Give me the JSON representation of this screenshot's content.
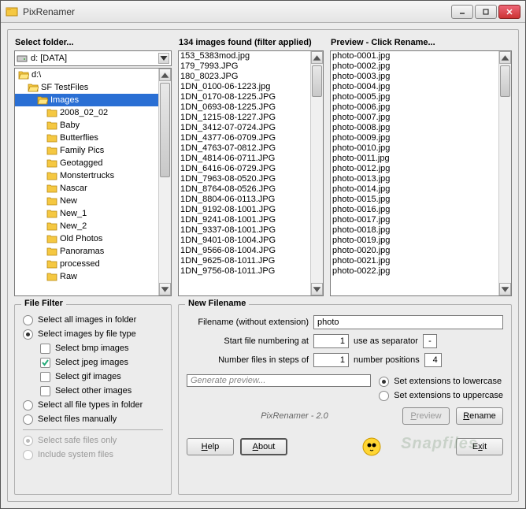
{
  "window": {
    "title": "PixRenamer"
  },
  "folder_panel": {
    "header": "Select folder...",
    "drive": "d: [DATA]",
    "tree": [
      {
        "label": "d:\\",
        "indent": 0,
        "open": true,
        "selected": false
      },
      {
        "label": "SF TestFiles",
        "indent": 1,
        "open": true,
        "selected": false
      },
      {
        "label": "Images",
        "indent": 2,
        "open": true,
        "selected": true
      },
      {
        "label": "2008_02_02",
        "indent": 3,
        "open": false,
        "selected": false
      },
      {
        "label": "Baby",
        "indent": 3,
        "open": false,
        "selected": false
      },
      {
        "label": "Butterflies",
        "indent": 3,
        "open": false,
        "selected": false
      },
      {
        "label": "Family Pics",
        "indent": 3,
        "open": false,
        "selected": false
      },
      {
        "label": "Geotagged",
        "indent": 3,
        "open": false,
        "selected": false
      },
      {
        "label": "Monstertrucks",
        "indent": 3,
        "open": false,
        "selected": false
      },
      {
        "label": "Nascar",
        "indent": 3,
        "open": false,
        "selected": false
      },
      {
        "label": "New",
        "indent": 3,
        "open": false,
        "selected": false
      },
      {
        "label": "New_1",
        "indent": 3,
        "open": false,
        "selected": false
      },
      {
        "label": "New_2",
        "indent": 3,
        "open": false,
        "selected": false
      },
      {
        "label": "Old Photos",
        "indent": 3,
        "open": false,
        "selected": false
      },
      {
        "label": "Panoramas",
        "indent": 3,
        "open": false,
        "selected": false
      },
      {
        "label": "processed",
        "indent": 3,
        "open": false,
        "selected": false
      },
      {
        "label": "Raw",
        "indent": 3,
        "open": false,
        "selected": false
      }
    ]
  },
  "images_panel": {
    "header": "134 images found (filter applied)",
    "items": [
      "153_5383mod.jpg",
      "179_7993.JPG",
      "180_8023.JPG",
      "1DN_0100-06-1223.jpg",
      "1DN_0170-08-1225.JPG",
      "1DN_0693-08-1225.JPG",
      "1DN_1215-08-1227.JPG",
      "1DN_3412-07-0724.JPG",
      "1DN_4377-06-0709.JPG",
      "1DN_4763-07-0812.JPG",
      "1DN_4814-06-0711.JPG",
      "1DN_6416-06-0729.JPG",
      "1DN_7963-08-0520.JPG",
      "1DN_8764-08-0526.JPG",
      "1DN_8804-06-0113.JPG",
      "1DN_9192-08-1001.JPG",
      "1DN_9241-08-1001.JPG",
      "1DN_9337-08-1001.JPG",
      "1DN_9401-08-1004.JPG",
      "1DN_9566-08-1004.JPG",
      "1DN_9625-08-1011.JPG",
      "1DN_9756-08-1011.JPG"
    ]
  },
  "preview_panel": {
    "header": "Preview - Click Rename...",
    "items": [
      "photo-0001.jpg",
      "photo-0002.jpg",
      "photo-0003.jpg",
      "photo-0004.jpg",
      "photo-0005.jpg",
      "photo-0006.jpg",
      "photo-0007.jpg",
      "photo-0008.jpg",
      "photo-0009.jpg",
      "photo-0010.jpg",
      "photo-0011.jpg",
      "photo-0012.jpg",
      "photo-0013.jpg",
      "photo-0014.jpg",
      "photo-0015.jpg",
      "photo-0016.jpg",
      "photo-0017.jpg",
      "photo-0018.jpg",
      "photo-0019.jpg",
      "photo-0020.jpg",
      "photo-0021.jpg",
      "photo-0022.jpg"
    ]
  },
  "filter": {
    "title": "File Filter",
    "opt_all_images": "Select all images in folder",
    "opt_by_type": "Select images by file type",
    "chk_bmp": "Select bmp images",
    "chk_jpeg": "Select jpeg images",
    "chk_gif": "Select gif images",
    "chk_other": "Select other images",
    "opt_all_types": "Select all file types in folder",
    "opt_manual": "Select files manually",
    "opt_safe": "Select safe files only",
    "opt_system": "Include system files",
    "selected_mode": "by_type",
    "jpeg_checked": true
  },
  "newfile": {
    "title": "New Filename",
    "label_name": "Filename (without extension)",
    "val_name": "photo",
    "label_start": "Start file numbering at",
    "val_start": "1",
    "label_sep": "use as separator",
    "val_sep": "-",
    "label_step": "Number files in steps of",
    "val_step": "1",
    "label_positions": "number positions",
    "val_positions": "4",
    "progress": "Generate preview...",
    "opt_lower": "Set extensions to lowercase",
    "opt_upper": "Set extensions to uppercase",
    "ext_mode": "lower",
    "version": "PixRenamer - 2.0"
  },
  "buttons": {
    "preview": "Preview",
    "rename": "Rename",
    "help": "Help",
    "about": "About",
    "exit": "Exit"
  }
}
